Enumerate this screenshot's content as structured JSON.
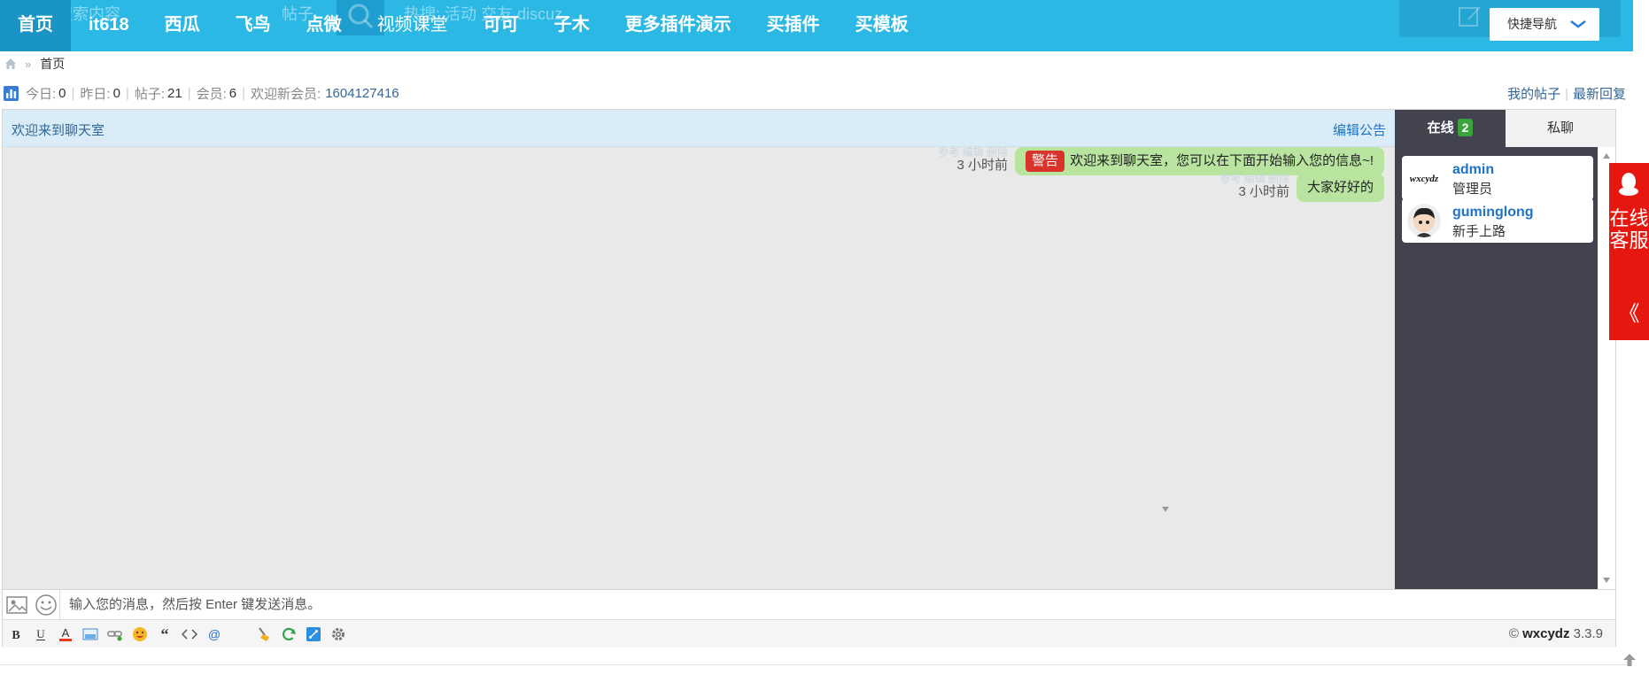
{
  "topnav": {
    "ghost": {
      "search_placeholder": "请输入搜索内容",
      "search_type": "帖子",
      "hot_words": "热搜: 活动 交友 discuz"
    },
    "items": [
      {
        "label": "首页",
        "active": true
      },
      {
        "label": "it618"
      },
      {
        "label": "西瓜"
      },
      {
        "label": "飞鸟"
      },
      {
        "label": "点微"
      },
      {
        "label": "视频课堂"
      },
      {
        "label": "可可"
      },
      {
        "label": "子木"
      },
      {
        "label": "更多插件演示"
      },
      {
        "label": "买插件"
      },
      {
        "label": "买模板"
      }
    ],
    "quick_nav_label": "快捷导航"
  },
  "breadcrumb": {
    "separator": "»",
    "current": "首页"
  },
  "stats": {
    "today_label": "今日:",
    "today": "0",
    "yesterday_label": "昨日:",
    "yesterday": "0",
    "posts_label": "帖子:",
    "posts": "21",
    "members_label": "会员:",
    "members": "6",
    "welcome_label": "欢迎新会员:",
    "new_member": "1604127416"
  },
  "top_links": {
    "my_posts": "我的帖子",
    "latest_replies": "最新回复"
  },
  "chat": {
    "notice": "欢迎来到聊天室",
    "edit_notice": "编辑公告",
    "messages": [
      {
        "actions": "参考 编辑 删除",
        "time": "3 小时前",
        "tag": "警告",
        "text": "欢迎来到聊天室，您可以在下面开始输入您的信息~!"
      },
      {
        "actions": "参考 编辑 删除",
        "time": "3 小时前",
        "text": "大家好好的"
      }
    ],
    "input_placeholder": "输入您的消息，然后按 Enter 键发送消息。",
    "version_prefix": "©",
    "version_name": "wxcydz",
    "version": "3.3.9"
  },
  "side": {
    "tab_online": "在线",
    "online_count": "2",
    "tab_private": "私聊",
    "users": [
      {
        "name": "admin",
        "role": "管理员",
        "avatar_text": "wxcydz"
      },
      {
        "name": "guminglong",
        "role": "新手上路"
      }
    ]
  },
  "service": {
    "text": "在线客服",
    "arrow": "《"
  },
  "colors": {
    "nav": "#2bb8e4",
    "nav_active": "#1a94c4",
    "bubble": "#b8e4a0",
    "warn": "#d9342b",
    "side_panel": "#43434f",
    "service": "#e6170f"
  }
}
